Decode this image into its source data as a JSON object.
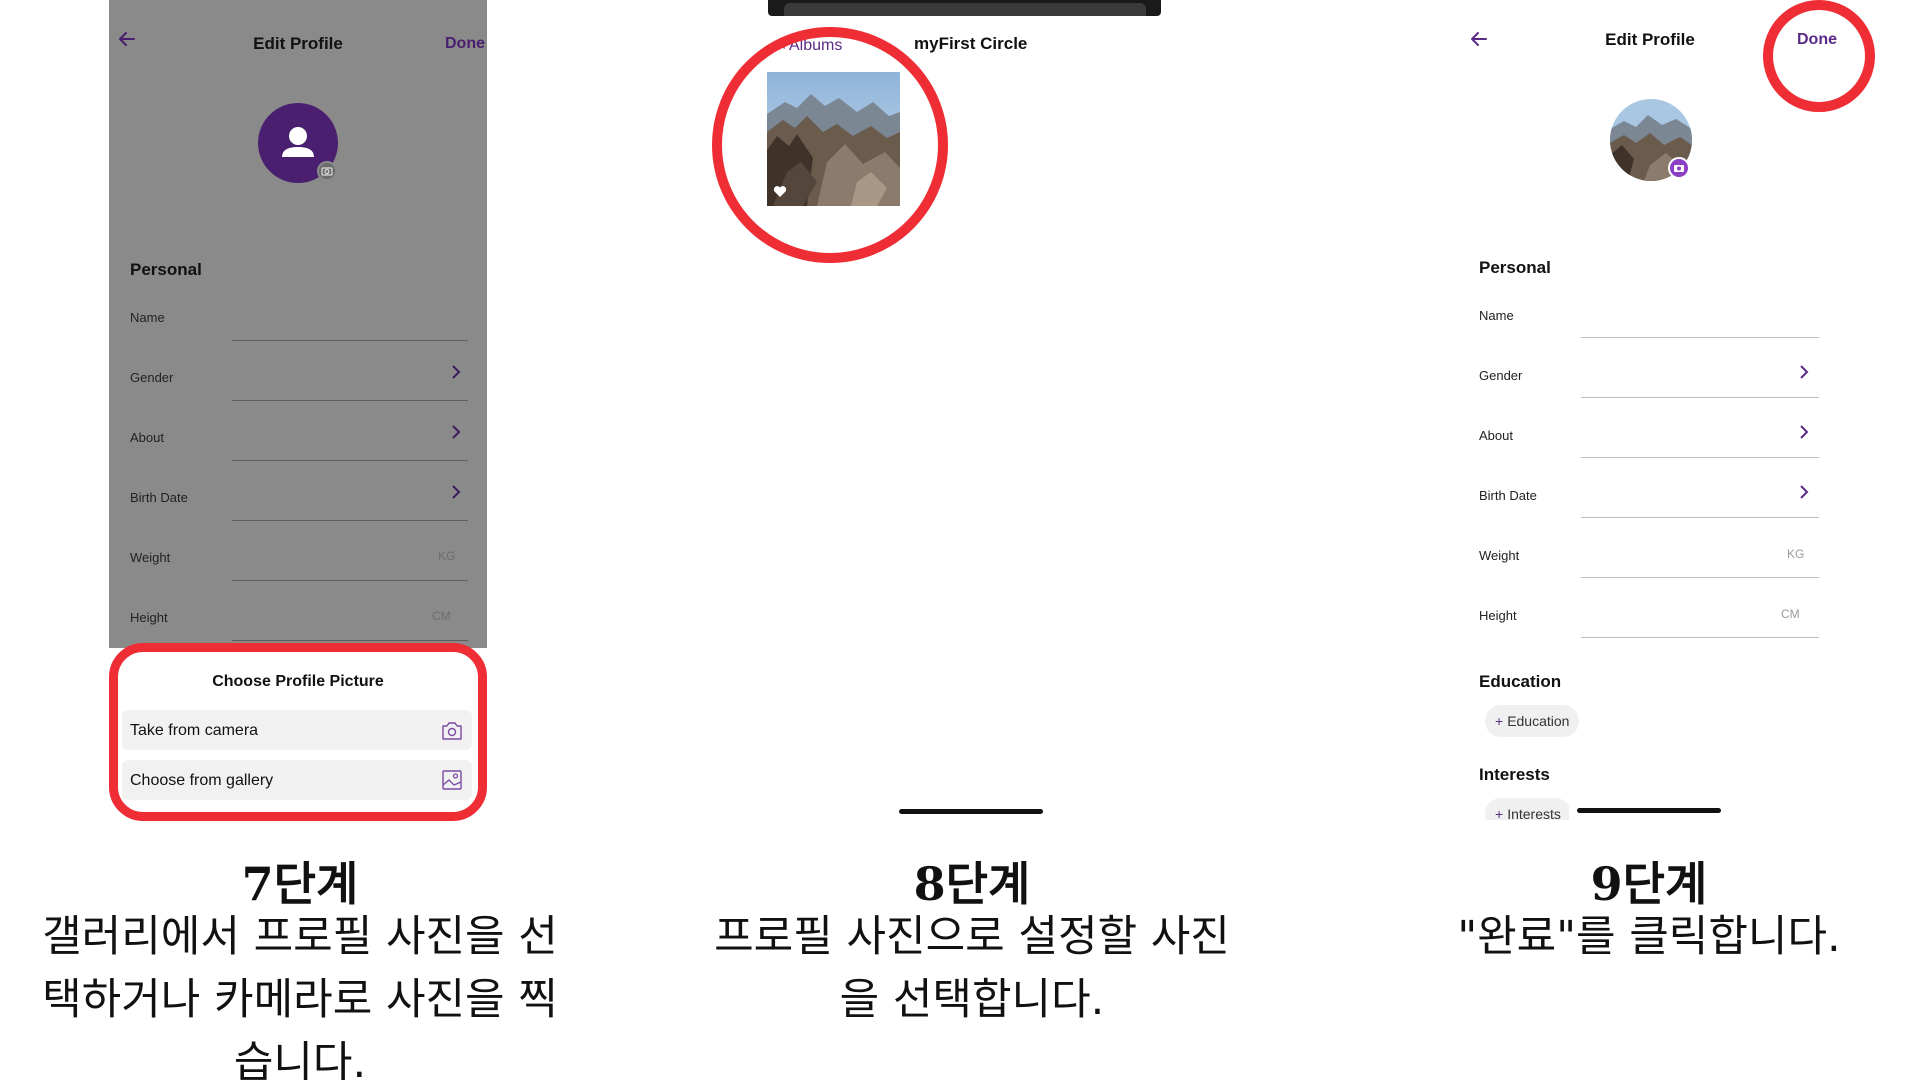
{
  "panel1": {
    "header": {
      "back_icon": "arrow-left-icon",
      "title": "Edit Profile",
      "done": "Done"
    },
    "avatar_icon": "person-icon",
    "badge_icon": "camera-icon",
    "section": "Personal",
    "fields": [
      {
        "label": "Name",
        "unit": ""
      },
      {
        "label": "Gender",
        "unit": ""
      },
      {
        "label": "About",
        "unit": ""
      },
      {
        "label": "Birth Date",
        "unit": ""
      },
      {
        "label": "Weight",
        "unit": "KG"
      },
      {
        "label": "Height",
        "unit": "CM"
      }
    ],
    "sheet": {
      "title": "Choose Profile Picture",
      "options": [
        {
          "label": "Take from camera",
          "icon": "camera-icon"
        },
        {
          "label": "Choose from gallery",
          "icon": "image-icon"
        }
      ]
    },
    "colors": {
      "overlay": "#8a8a8a",
      "accent": "#4a1f70",
      "highlight": "#ee2d35"
    }
  },
  "panel2": {
    "back_link": "Albums",
    "title": "myFirst Circle",
    "favorite_icon": "heart-icon"
  },
  "panel3": {
    "header": {
      "back_icon": "arrow-left-icon",
      "title": "Edit Profile",
      "done": "Done"
    },
    "section": "Personal",
    "fields": [
      {
        "label": "Name",
        "unit": ""
      },
      {
        "label": "Gender",
        "unit": ""
      },
      {
        "label": "About",
        "unit": ""
      },
      {
        "label": "Birth Date",
        "unit": ""
      },
      {
        "label": "Weight",
        "unit": "KG"
      },
      {
        "label": "Height",
        "unit": "CM"
      }
    ],
    "education": {
      "title": "Education",
      "chip": "Education"
    },
    "interests": {
      "title": "Interests",
      "chip": "Interests"
    },
    "colors": {
      "accent": "#5b2a86",
      "badge": "#8a3fc4"
    }
  },
  "captions": [
    {
      "step": "7단계",
      "lines": [
        "갤러리에서 프로필 사진을 선",
        "택하거나 카메라로 사진을 찍",
        "습니다."
      ]
    },
    {
      "step": "8단계",
      "lines": [
        "프로필 사진으로 설정할 사진",
        "을 선택합니다."
      ]
    },
    {
      "step": "9단계",
      "lines": [
        "\"완료\"를 클릭합니다."
      ]
    }
  ]
}
